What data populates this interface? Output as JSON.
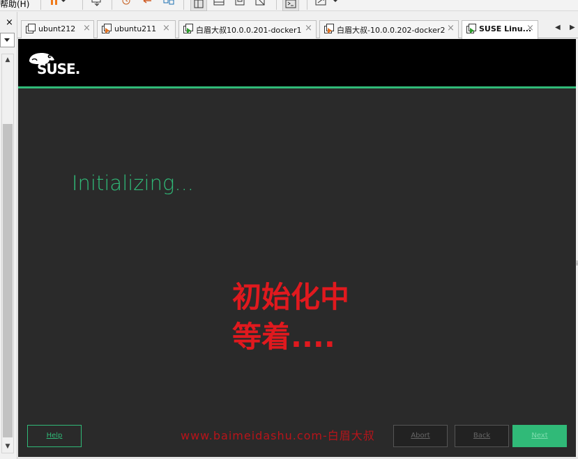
{
  "toolbar": {
    "help_menu": "帮助(H)"
  },
  "left_panel": {
    "close_glyph": "×"
  },
  "tabs": [
    {
      "label": "ubunt212",
      "running": false
    },
    {
      "label": "ubuntu211",
      "running": false
    },
    {
      "label": "白眉大叔10.0.0.201-docker1",
      "running": true
    },
    {
      "label": "白眉大叔-10.0.0.202-docker2",
      "running": true
    },
    {
      "label": "SUSE Linu...",
      "running": true,
      "active": true
    }
  ],
  "tab_close_glyph": "×",
  "guest": {
    "logo_text": "SUSE.",
    "status_text": "Initializing...",
    "overlay_line1": "初始化中",
    "overlay_line2": "等着....",
    "watermark": "www.baimeidashu.com-白眉大叔",
    "buttons": {
      "help": "Help",
      "abort": "Abort",
      "back": "Back",
      "next": "Next"
    }
  },
  "colors": {
    "suse_green": "#30ba78",
    "overlay_red": "#e0191e",
    "guest_bg": "#2a2a2a"
  }
}
